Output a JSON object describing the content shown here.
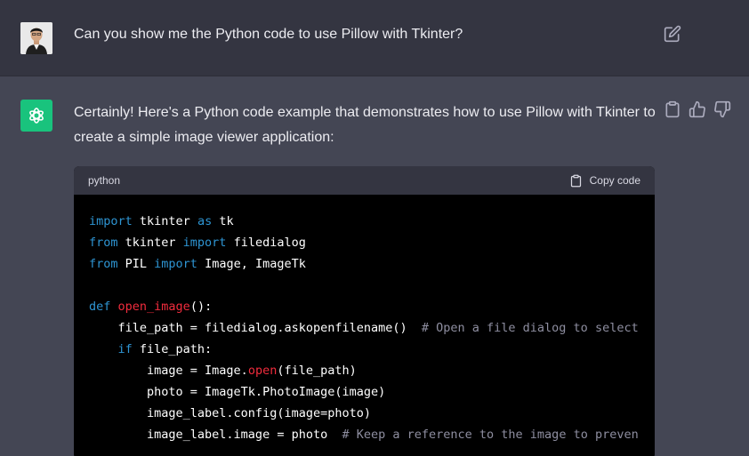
{
  "user_message": {
    "text": "Can you show me the Python code to use Pillow with Tkinter?"
  },
  "assistant_message": {
    "text": "Certainly! Here's a Python code example that demonstrates how to use Pillow with Tkinter to create a simple image viewer application:",
    "code": {
      "language": "python",
      "copy_label": "Copy code",
      "lines": [
        [
          {
            "t": "import",
            "c": "kw"
          },
          {
            "t": " tkinter "
          },
          {
            "t": "as",
            "c": "kw"
          },
          {
            "t": " tk"
          }
        ],
        [
          {
            "t": "from",
            "c": "kw"
          },
          {
            "t": " tkinter "
          },
          {
            "t": "import",
            "c": "kw"
          },
          {
            "t": " filedialog"
          }
        ],
        [
          {
            "t": "from",
            "c": "kw"
          },
          {
            "t": " PIL "
          },
          {
            "t": "import",
            "c": "kw"
          },
          {
            "t": " Image, ImageTk"
          }
        ],
        [
          {
            "t": ""
          }
        ],
        [
          {
            "t": "def",
            "c": "kw"
          },
          {
            "t": " "
          },
          {
            "t": "open_image",
            "c": "fn"
          },
          {
            "t": "():"
          }
        ],
        [
          {
            "t": "    file_path = filedialog.askopenfilename()  "
          },
          {
            "t": "# Open a file dialog to select",
            "c": "cm"
          }
        ],
        [
          {
            "t": "    "
          },
          {
            "t": "if",
            "c": "kw"
          },
          {
            "t": " file_path:"
          }
        ],
        [
          {
            "t": "        image = Image."
          },
          {
            "t": "open",
            "c": "fn"
          },
          {
            "t": "(file_path)"
          }
        ],
        [
          {
            "t": "        photo = ImageTk.PhotoImage(image)"
          }
        ],
        [
          {
            "t": "        image_label.config(image=photo)"
          }
        ],
        [
          {
            "t": "        image_label.image = photo  "
          },
          {
            "t": "# Keep a reference to the image to preven",
            "c": "cm"
          }
        ]
      ]
    }
  },
  "colors": {
    "user_bg": "#343541",
    "assistant_bg": "#444654",
    "bot_avatar": "#19c37d",
    "keyword": "#2e95d3",
    "function": "#f22c3d",
    "comment": "#8e8ea0"
  },
  "icons": [
    "user-avatar",
    "edit-icon",
    "openai-logo-icon",
    "copy-icon",
    "thumbs-up-icon",
    "thumbs-down-icon",
    "clipboard-icon"
  ]
}
